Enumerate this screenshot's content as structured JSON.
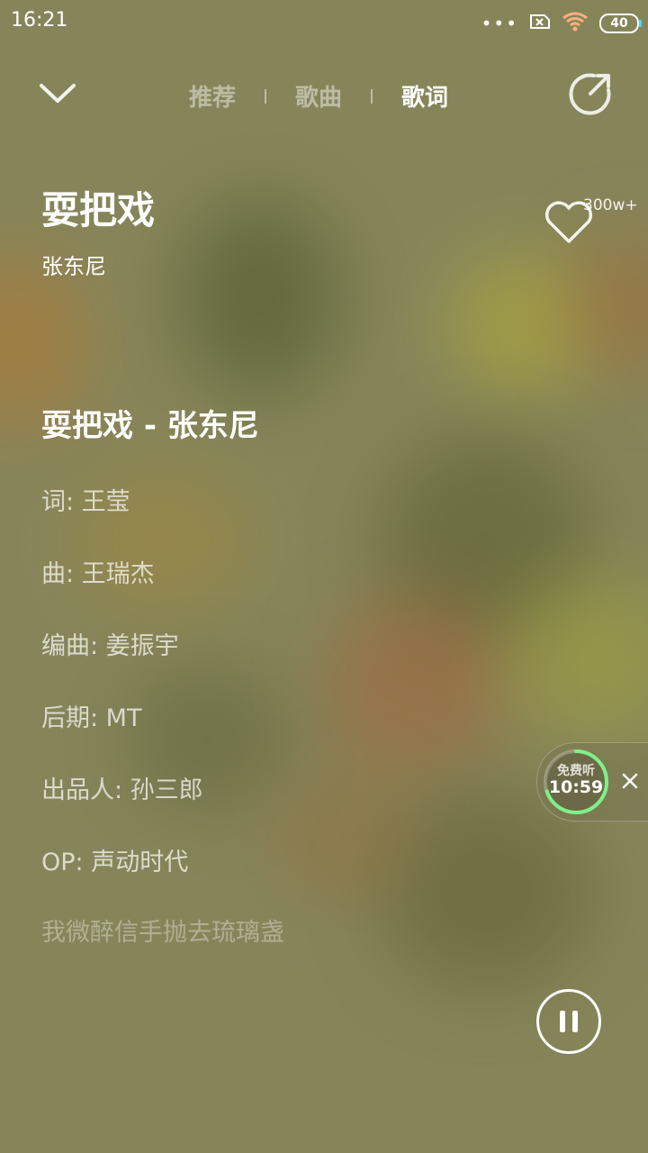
{
  "status_bar": {
    "time": "16:21",
    "battery": "40",
    "icons": [
      "more-dots-icon",
      "sim-error-icon",
      "wifi-icon",
      "battery-icon"
    ]
  },
  "nav": {
    "tabs": [
      {
        "label": "推荐",
        "active": false
      },
      {
        "label": "歌曲",
        "active": false
      },
      {
        "label": "歌词",
        "active": true
      }
    ]
  },
  "song": {
    "title": "耍把戏",
    "artist": "张东尼",
    "favorite_count": "300w+"
  },
  "lyrics": {
    "heading": "耍把戏 - 张东尼",
    "lines": [
      "词: 王莹",
      "曲: 王瑞杰",
      "编曲: 姜振宇",
      "后期: MT",
      "出品人: 孙三郎",
      "OP: 声动时代",
      "我微醉信手抛去琉璃盏"
    ]
  },
  "free_listen": {
    "label": "免费听",
    "timer": "10:59",
    "progress": 0.7
  },
  "colors": {
    "background": "#86855a",
    "accent_green": "#7ef08a"
  }
}
